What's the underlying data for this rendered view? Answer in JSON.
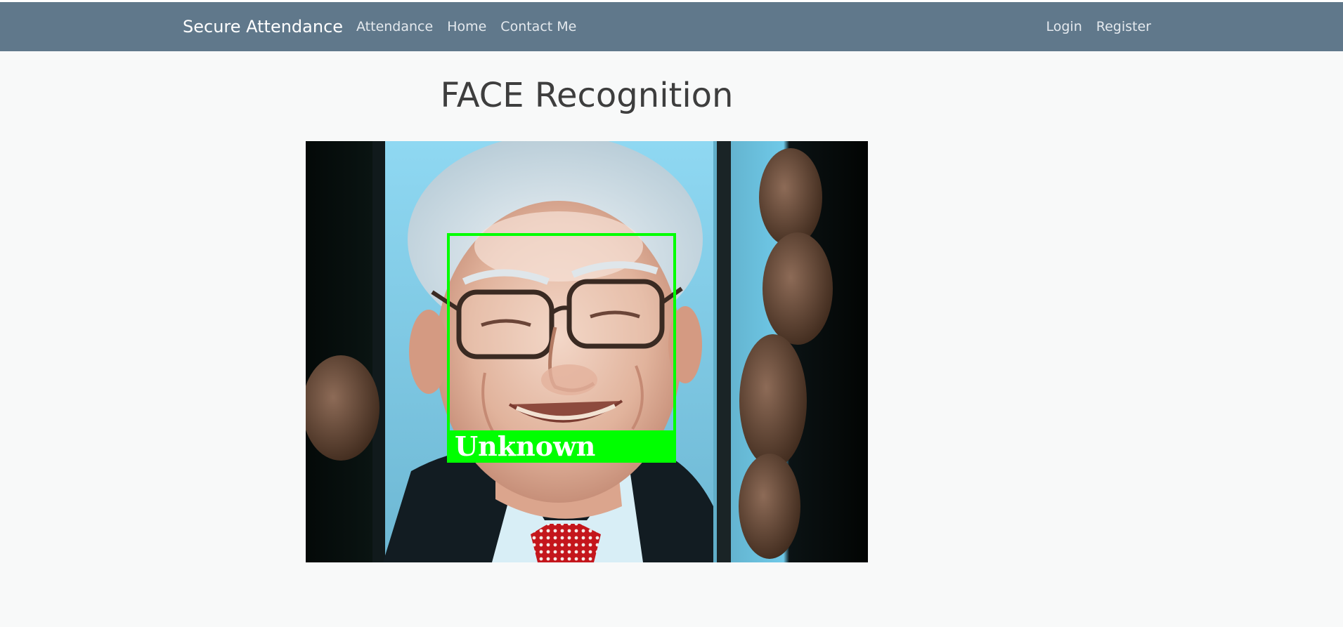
{
  "navbar": {
    "brand": "Secure Attendance",
    "links": [
      {
        "label": "Attendance"
      },
      {
        "label": "Home"
      },
      {
        "label": "Contact Me"
      }
    ],
    "auth_links": [
      {
        "label": "Login"
      },
      {
        "label": "Register"
      }
    ]
  },
  "main": {
    "title": "FACE Recognition",
    "video_feed": {
      "detection_label": "Unknown",
      "box_color": "#00ff00"
    }
  },
  "colors": {
    "navbar": "#60788b",
    "background": "#f8f9f9",
    "title": "#3e3e3e"
  }
}
